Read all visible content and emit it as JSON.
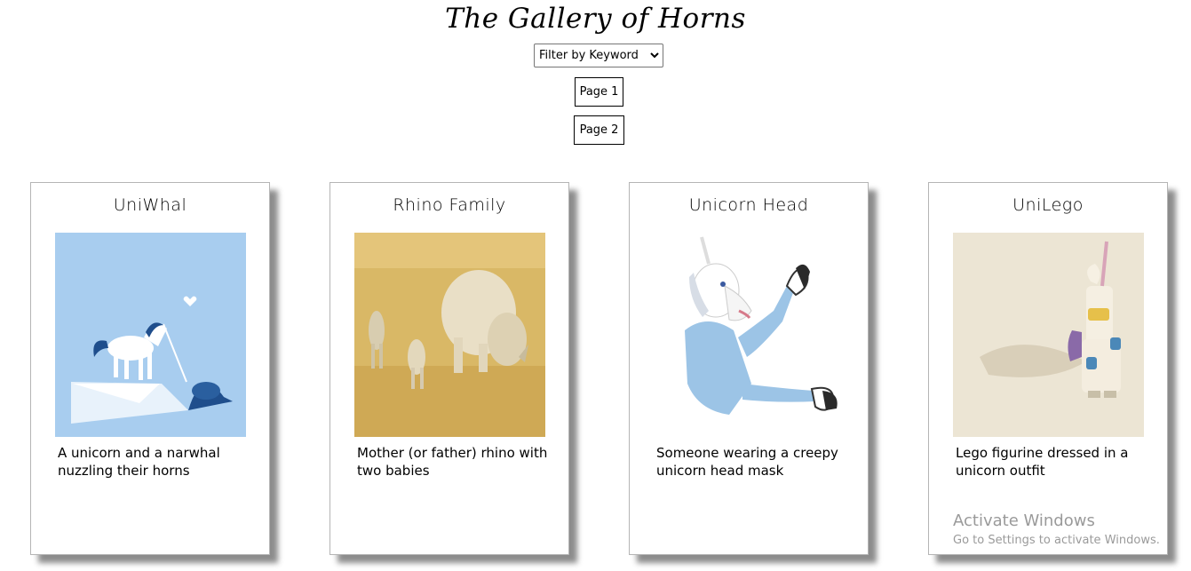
{
  "header": {
    "title": "The Gallery of Horns",
    "filter_selected": "Filter by Keyword",
    "pages": [
      "Page 1",
      "Page 2"
    ]
  },
  "cards": [
    {
      "title": "UniWhal",
      "description": "A unicorn and a narwhal nuzzling their horns",
      "image_icon": "unicorn-narwhal-illustration"
    },
    {
      "title": "Rhino Family",
      "description": "Mother (or father) rhino with two babies",
      "image_icon": "rhino-family-photo"
    },
    {
      "title": "Unicorn Head",
      "description": "Someone wearing a creepy unicorn head mask",
      "image_icon": "unicorn-mask-person-photo"
    },
    {
      "title": "UniLego",
      "description": "Lego figurine dressed in a unicorn outfit",
      "image_icon": "lego-unicorn-photo"
    }
  ],
  "watermark": {
    "title": "Activate Windows",
    "subtitle": "Go to Settings to activate Windows."
  },
  "colors": {
    "card_border": "#b5b5b5",
    "narwhal_bg": "#a8cdef",
    "rhino_bg": "#d9b866",
    "lego_bg": "#ece5d4"
  }
}
